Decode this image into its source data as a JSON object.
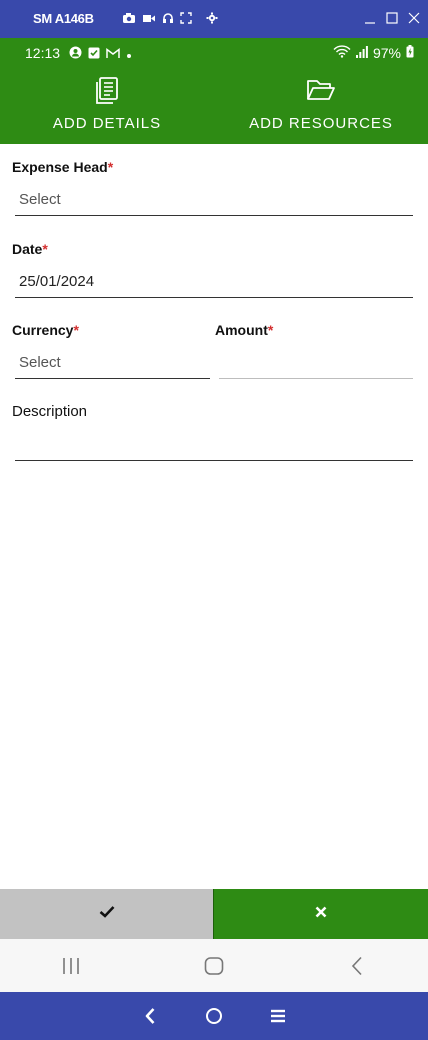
{
  "window": {
    "device_name": "SM A146B",
    "tool_icons": [
      "camera-icon",
      "video-icon",
      "headphones-icon",
      "fullscreen-icon",
      "settings-icon"
    ],
    "controls": [
      "minimize-icon",
      "maximize-icon",
      "close-icon"
    ]
  },
  "status_bar": {
    "time": "12:13",
    "battery": "97%"
  },
  "tabs": [
    {
      "label": "ADD DETAILS",
      "icon": "document-icon"
    },
    {
      "label": "ADD RESOURCES",
      "icon": "folder-open-icon"
    }
  ],
  "form": {
    "expense_head": {
      "label": "Expense Head",
      "required": "*",
      "value": "Select"
    },
    "date": {
      "label": "Date",
      "required": "*",
      "value": "25/01/2024"
    },
    "currency": {
      "label": "Currency",
      "required": "*",
      "value": "Select"
    },
    "amount": {
      "label": "Amount",
      "required": "*",
      "value": ""
    },
    "description": {
      "label": "Description",
      "value": ""
    }
  },
  "actions": {
    "confirm_icon": "check-icon",
    "cancel_icon": "close-icon"
  },
  "colors": {
    "primary_green": "#2e8b14",
    "mirror_blue": "#3949ab",
    "required_red": "#d32f2f",
    "confirm_gray": "#c2c2c2"
  }
}
